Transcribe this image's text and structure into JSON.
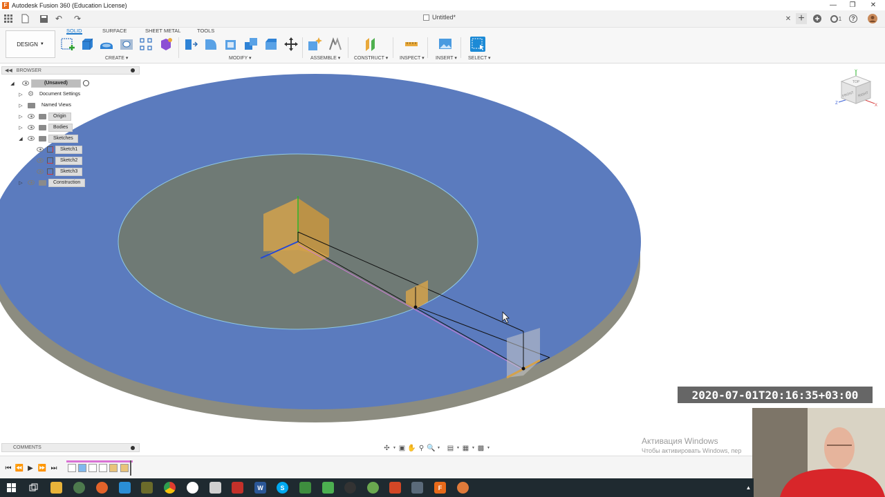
{
  "window": {
    "title": "Autodesk Fusion 360 (Education License)",
    "app_icon_letter": "F",
    "minimize": "—",
    "restore": "❐",
    "close": "✕"
  },
  "quick_access": {
    "document_tab": "Untitled*",
    "tab_close": "✕",
    "new_tab": "+",
    "job_count": "1",
    "help": "?"
  },
  "toolbar": {
    "workspace_button": "DESIGN",
    "tabs": [
      "SOLID",
      "SURFACE",
      "SHEET METAL",
      "TOOLS"
    ],
    "groups": [
      "CREATE",
      "MODIFY",
      "ASSEMBLE",
      "CONSTRUCT",
      "INSPECT",
      "INSERT",
      "SELECT"
    ]
  },
  "browser": {
    "header": "BROWSER",
    "items": [
      {
        "label": "(Unsaved)"
      },
      {
        "label": "Document Settings"
      },
      {
        "label": "Named Views"
      },
      {
        "label": "Origin"
      },
      {
        "label": "Bodies"
      },
      {
        "label": "Sketches"
      },
      {
        "label": "Sketch1"
      },
      {
        "label": "Sketch2"
      },
      {
        "label": "Sketch3"
      },
      {
        "label": "Construction"
      }
    ]
  },
  "viewcube": {
    "top": "TOP",
    "front": "FRONT",
    "right": "RIGHT",
    "axis_x": "X",
    "axis_y": "Y",
    "axis_z": "Z"
  },
  "comments": {
    "header": "COMMENTS"
  },
  "overlay": {
    "timestamp": "2020-07-01T20:16:35+03:00",
    "activation_title": "Активация Windows",
    "activation_text": "Чтобы активировать Windows, пер"
  },
  "taskbar": {
    "word_letter": "W",
    "skype_letter": "S",
    "fusion_letter": "F"
  },
  "colors": {
    "accent": "#1a76c9",
    "disc_top": "#5b7bbe",
    "disc_side": "#8c8c80",
    "inner_circle": "#6f7a75",
    "sketch_plane": "#d4a24c",
    "taskbar": "#1f2a30"
  }
}
